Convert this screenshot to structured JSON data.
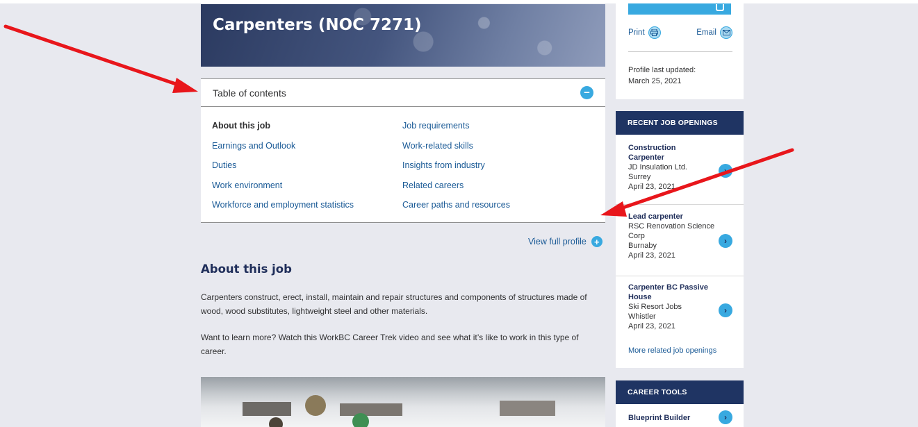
{
  "hero": {
    "title": "Carpenters (NOC 7271)"
  },
  "toc": {
    "title": "Table of contents",
    "collapse_symbol": "−",
    "col1": [
      "About this job",
      "Earnings and Outlook",
      "Duties",
      "Work environment",
      "Workforce and employment statistics"
    ],
    "col2": [
      "Job requirements",
      "Work-related skills",
      "Insights from industry",
      "Related careers",
      "Career paths and resources"
    ]
  },
  "view_full": {
    "label": "View full profile",
    "symbol": "+"
  },
  "about": {
    "title": "About this job",
    "p1": "Carpenters construct, erect, install, maintain and repair structures and components of structures made of wood, wood substitutes, lightweight steel and other materials.",
    "p2": "Want to learn more? Watch this WorkBC Career Trek video and see what it’s like to work in this type of career."
  },
  "sidebar": {
    "print_label": "Print",
    "email_label": "Email",
    "updated_label": "Profile last updated:",
    "updated_date": "March 25, 2021",
    "recent_head": "RECENT JOB OPENINGS",
    "jobs": [
      {
        "title": "Construction Carpenter",
        "employer": "JD Insulation Ltd.",
        "location": "Surrey",
        "date": "April 23, 2021"
      },
      {
        "title": "Lead carpenter",
        "employer": "RSC Renovation Science Corp",
        "location": "Burnaby",
        "date": "April 23, 2021"
      },
      {
        "title": "Carpenter BC Passive House",
        "employer": "Ski Resort Jobs",
        "location": "Whistler",
        "date": "April 23, 2021"
      }
    ],
    "more_jobs": "More related job openings",
    "tools_head": "CAREER TOOLS",
    "tools": [
      {
        "title": "Blueprint Builder"
      }
    ],
    "arrow_symbol": "›"
  },
  "colors": {
    "accent": "#38a9e0",
    "navy": "#1f3463",
    "link": "#1a5a96",
    "annotation": "#e8161b"
  },
  "icons": [
    "print-icon",
    "email-icon",
    "chevron-right-icon",
    "minus-icon",
    "plus-icon"
  ]
}
